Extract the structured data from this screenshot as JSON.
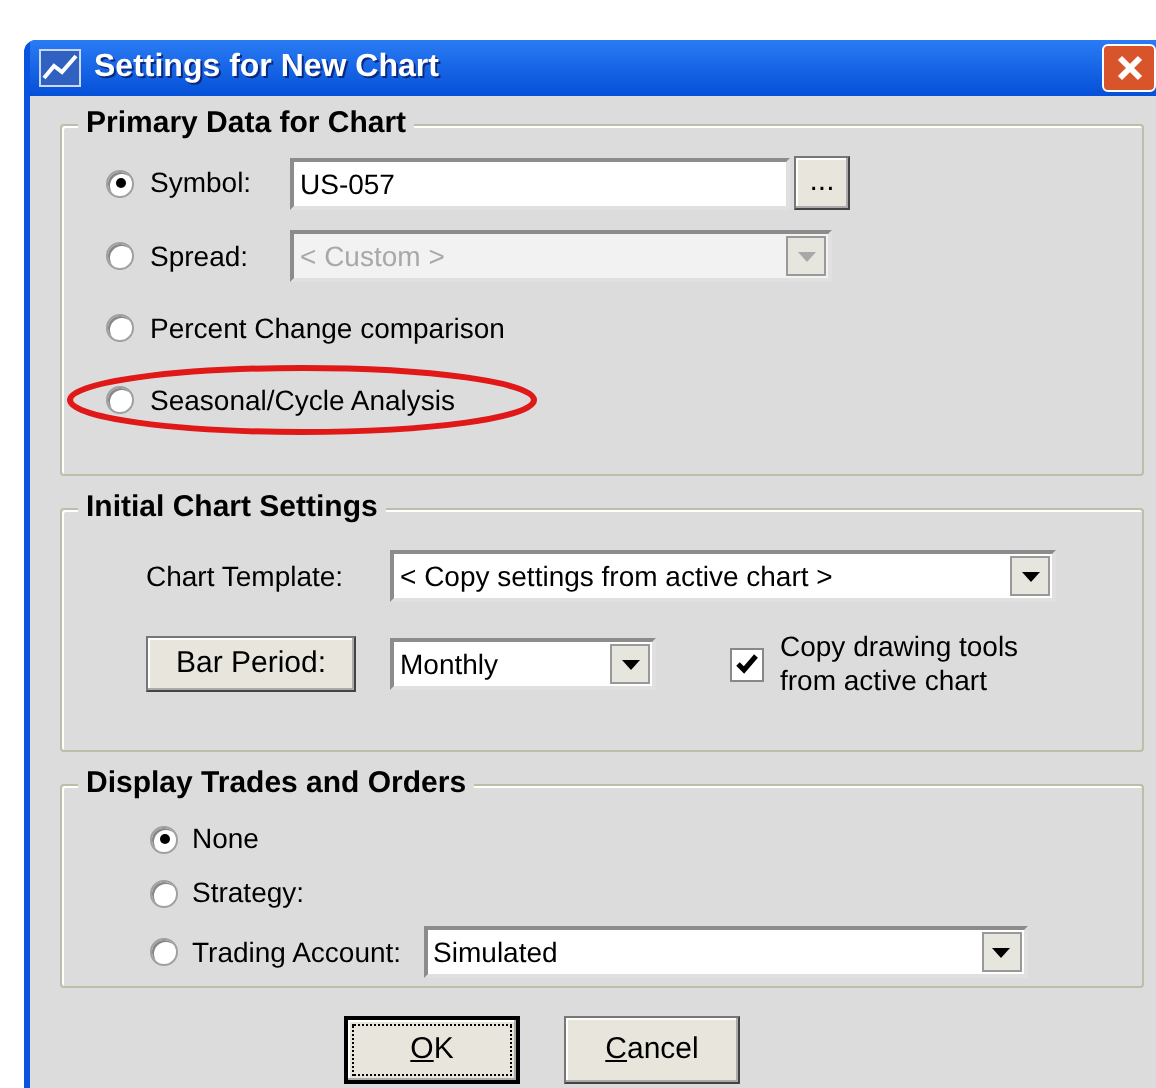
{
  "window": {
    "title": "Settings for New Chart"
  },
  "primary_data": {
    "title": "Primary Data for Chart",
    "options": [
      {
        "kind": "text",
        "label": "Symbol:",
        "selected": true,
        "value": "US-057",
        "button": "...",
        "disabled": false
      },
      {
        "kind": "combo",
        "label": "Spread:",
        "selected": false,
        "value": "< Custom >",
        "disabled": true
      },
      {
        "kind": "plain",
        "label": "Percent Change comparison",
        "selected": false
      },
      {
        "kind": "plain",
        "label": "Seasonal/Cycle Analysis",
        "selected": false,
        "highlighted": true
      }
    ]
  },
  "initial_chart_settings": {
    "title": "Initial Chart Settings",
    "chart_template": {
      "label": "Chart Template:",
      "value": "< Copy settings from active chart >"
    },
    "bar_period": {
      "button": "Bar Period:",
      "value": "Monthly"
    },
    "copy_drawing_tools": {
      "label": "Copy drawing tools from active chart",
      "checked": true
    }
  },
  "display_trades": {
    "title": "Display Trades and Orders",
    "options": [
      {
        "kind": "plain",
        "label": "None",
        "selected": true
      },
      {
        "kind": "plain",
        "label": "Strategy:",
        "selected": false
      },
      {
        "kind": "combo",
        "label": "Trading Account:",
        "selected": false,
        "value": "Simulated"
      }
    ]
  },
  "buttons": [
    {
      "label": "OK",
      "focused": true
    },
    {
      "label": "Cancel",
      "focused": false
    }
  ]
}
